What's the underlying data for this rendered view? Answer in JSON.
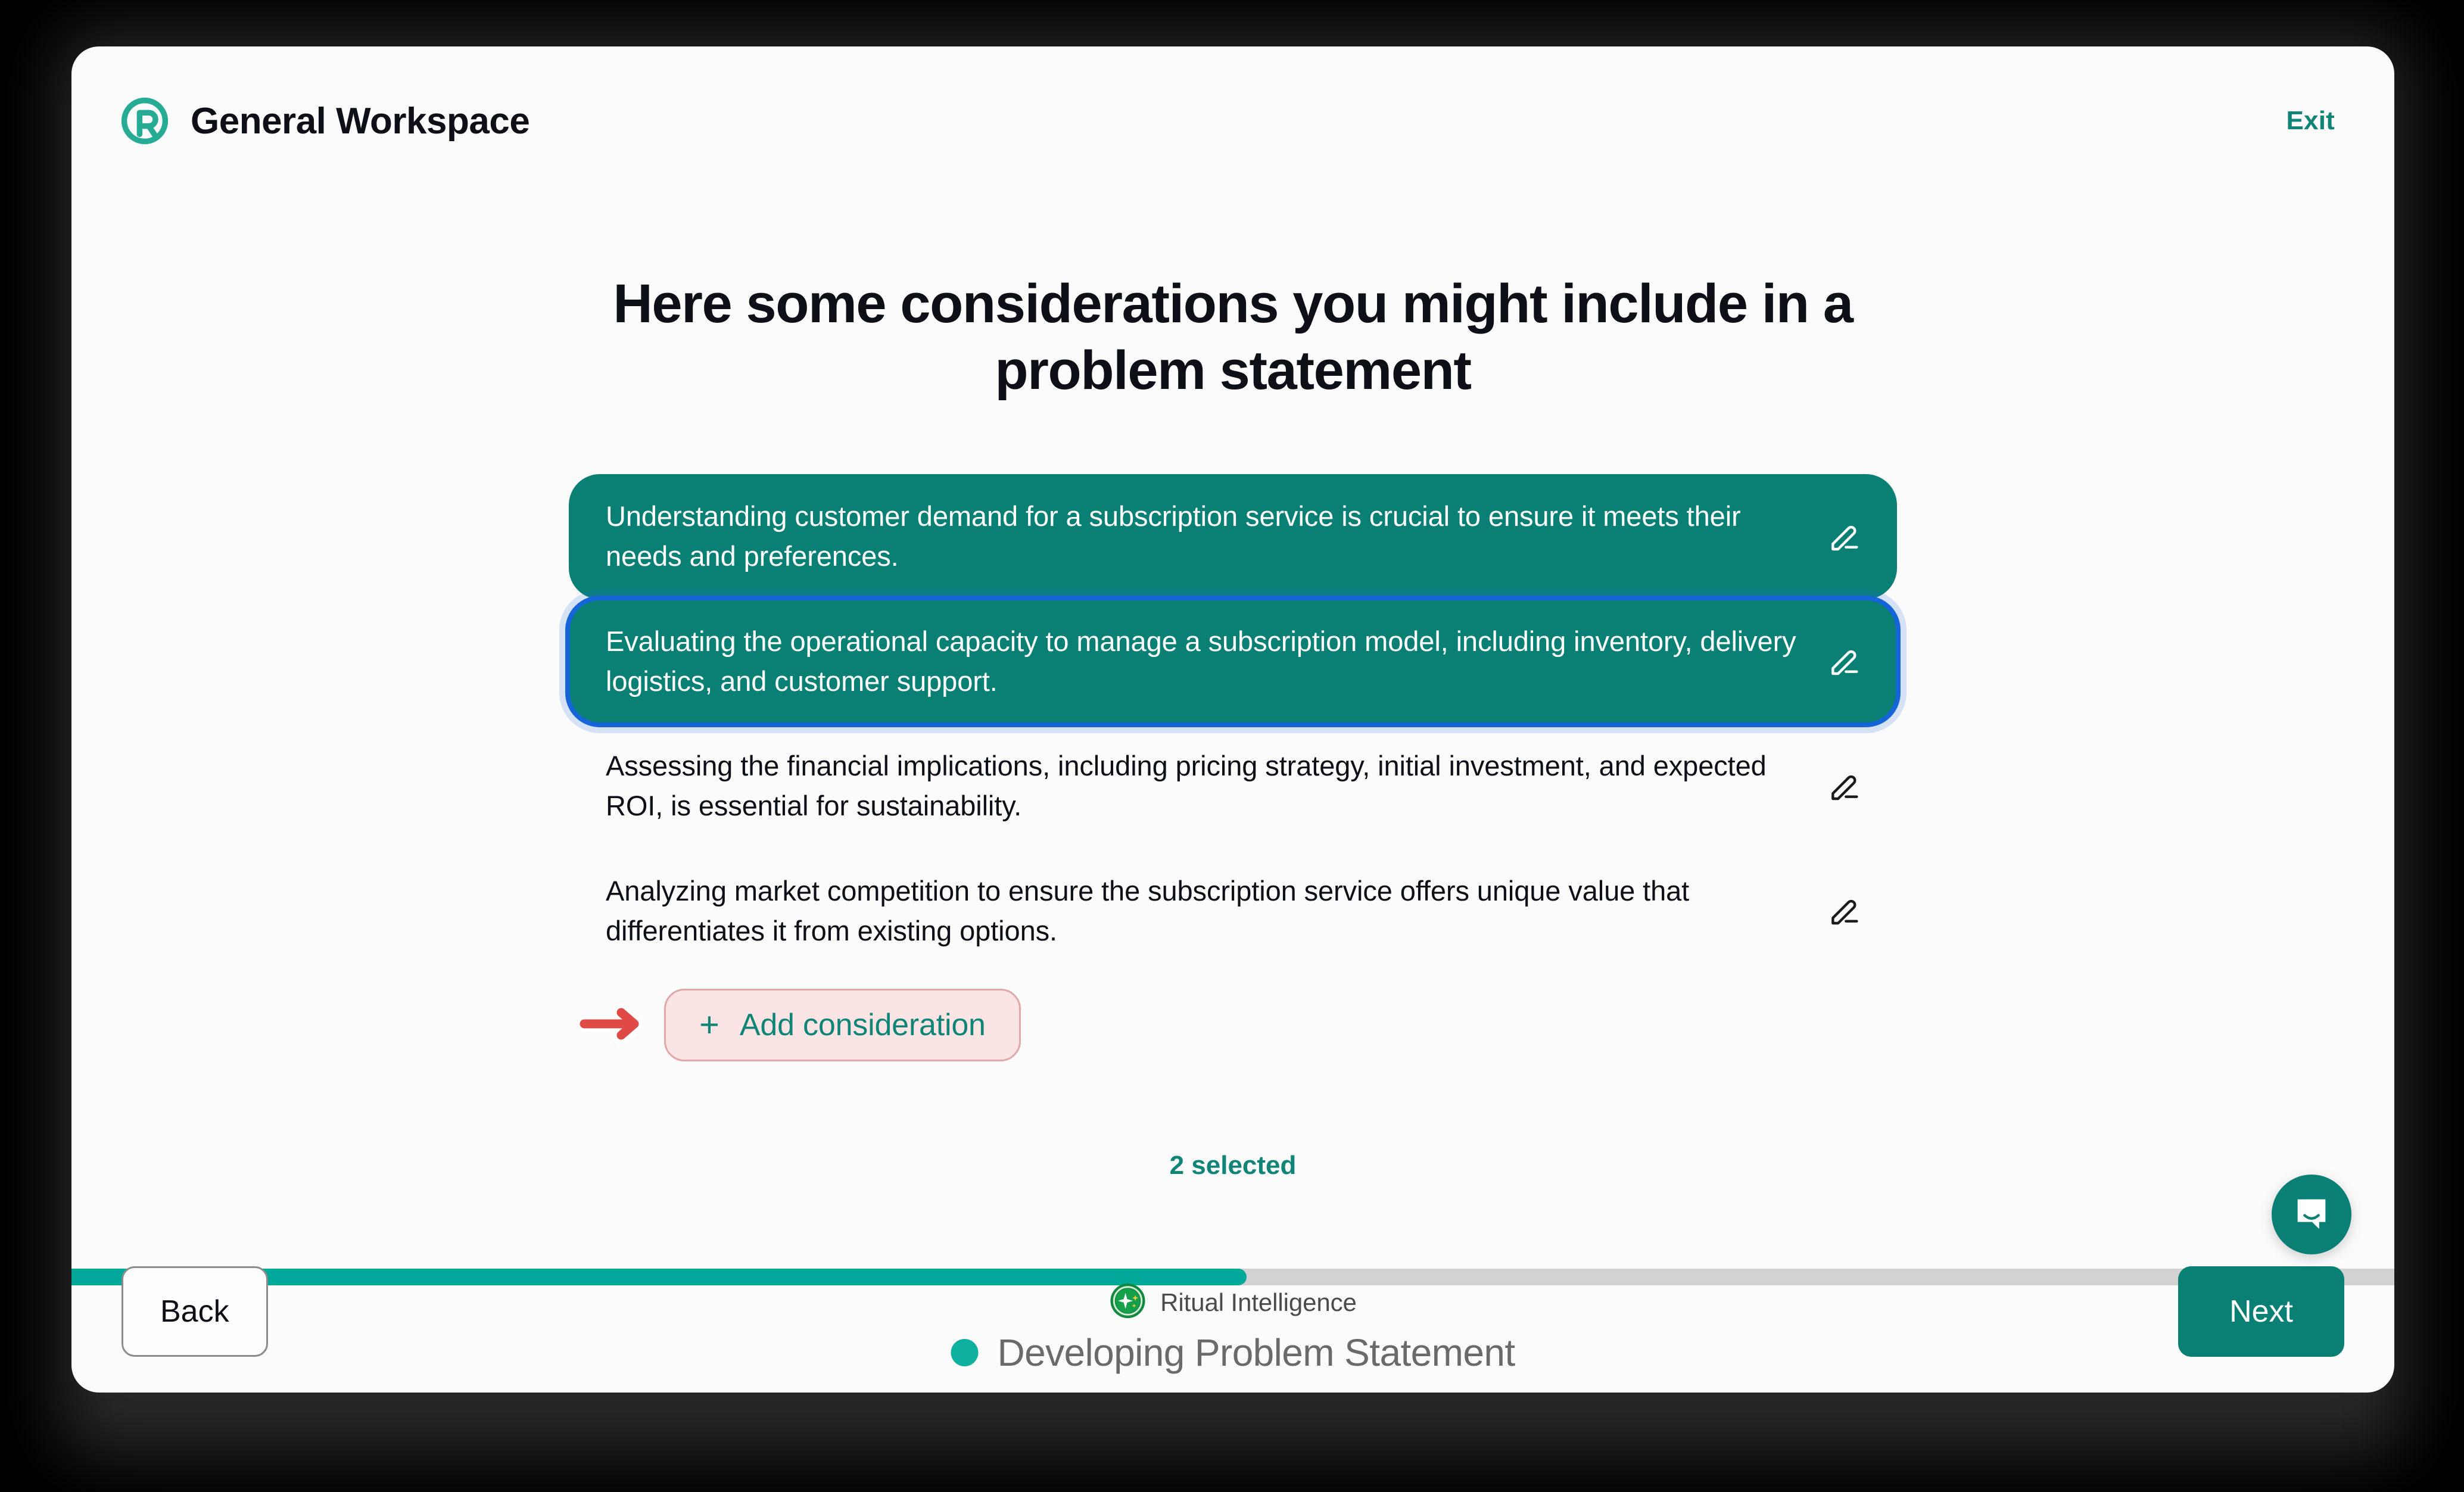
{
  "brand": {
    "title": "General Workspace",
    "logo_icon": "ritual-logo-icon",
    "logo_color": "#26ab95"
  },
  "header": {
    "exit_label": "Exit"
  },
  "main": {
    "heading": "Here some considerations you might include in a problem statement",
    "considerations": [
      {
        "text": "Understanding customer demand for a subscription service is crucial to ensure it meets their needs and preferences.",
        "selected": true,
        "focused": false,
        "edit_icon": "pencil-icon"
      },
      {
        "text": "Evaluating the operational capacity to manage a subscription model, including inventory, delivery logistics, and customer support.",
        "selected": true,
        "focused": true,
        "edit_icon": "pencil-icon"
      },
      {
        "text": "Assessing the financial implications, including pricing strategy, initial investment, and expected ROI, is essential for sustainability.",
        "selected": false,
        "focused": false,
        "edit_icon": "pencil-icon"
      },
      {
        "text": "Analyzing market competition to ensure the subscription service offers unique value that differentiates it from existing options.",
        "selected": false,
        "focused": false,
        "edit_icon": "pencil-icon"
      }
    ],
    "add_button": {
      "label": "Add consideration",
      "plus_icon": "plus-icon",
      "annotation_arrow": "red-arrow-icon",
      "highlight_color": "#fbe4e4",
      "highlight_border": "#e2a7a7",
      "arrow_color": "#e04a46"
    },
    "selected_count_label": "2 selected"
  },
  "progress": {
    "percent": 50.6,
    "fill_color": "#00a99a",
    "track_color": "#d2d2d2"
  },
  "footer": {
    "back_label": "Back",
    "next_label": "Next",
    "ritual_intelligence_label": "Ritual Intelligence",
    "ritual_intelligence_icon": "sparkle-badge-icon",
    "stage_label": "Developing Problem Statement",
    "stage_dot_color": "#0fb0a0",
    "next_color": "#0a8075"
  },
  "intercom": {
    "icon": "chat-bubble-icon",
    "color": "#0a8075"
  }
}
